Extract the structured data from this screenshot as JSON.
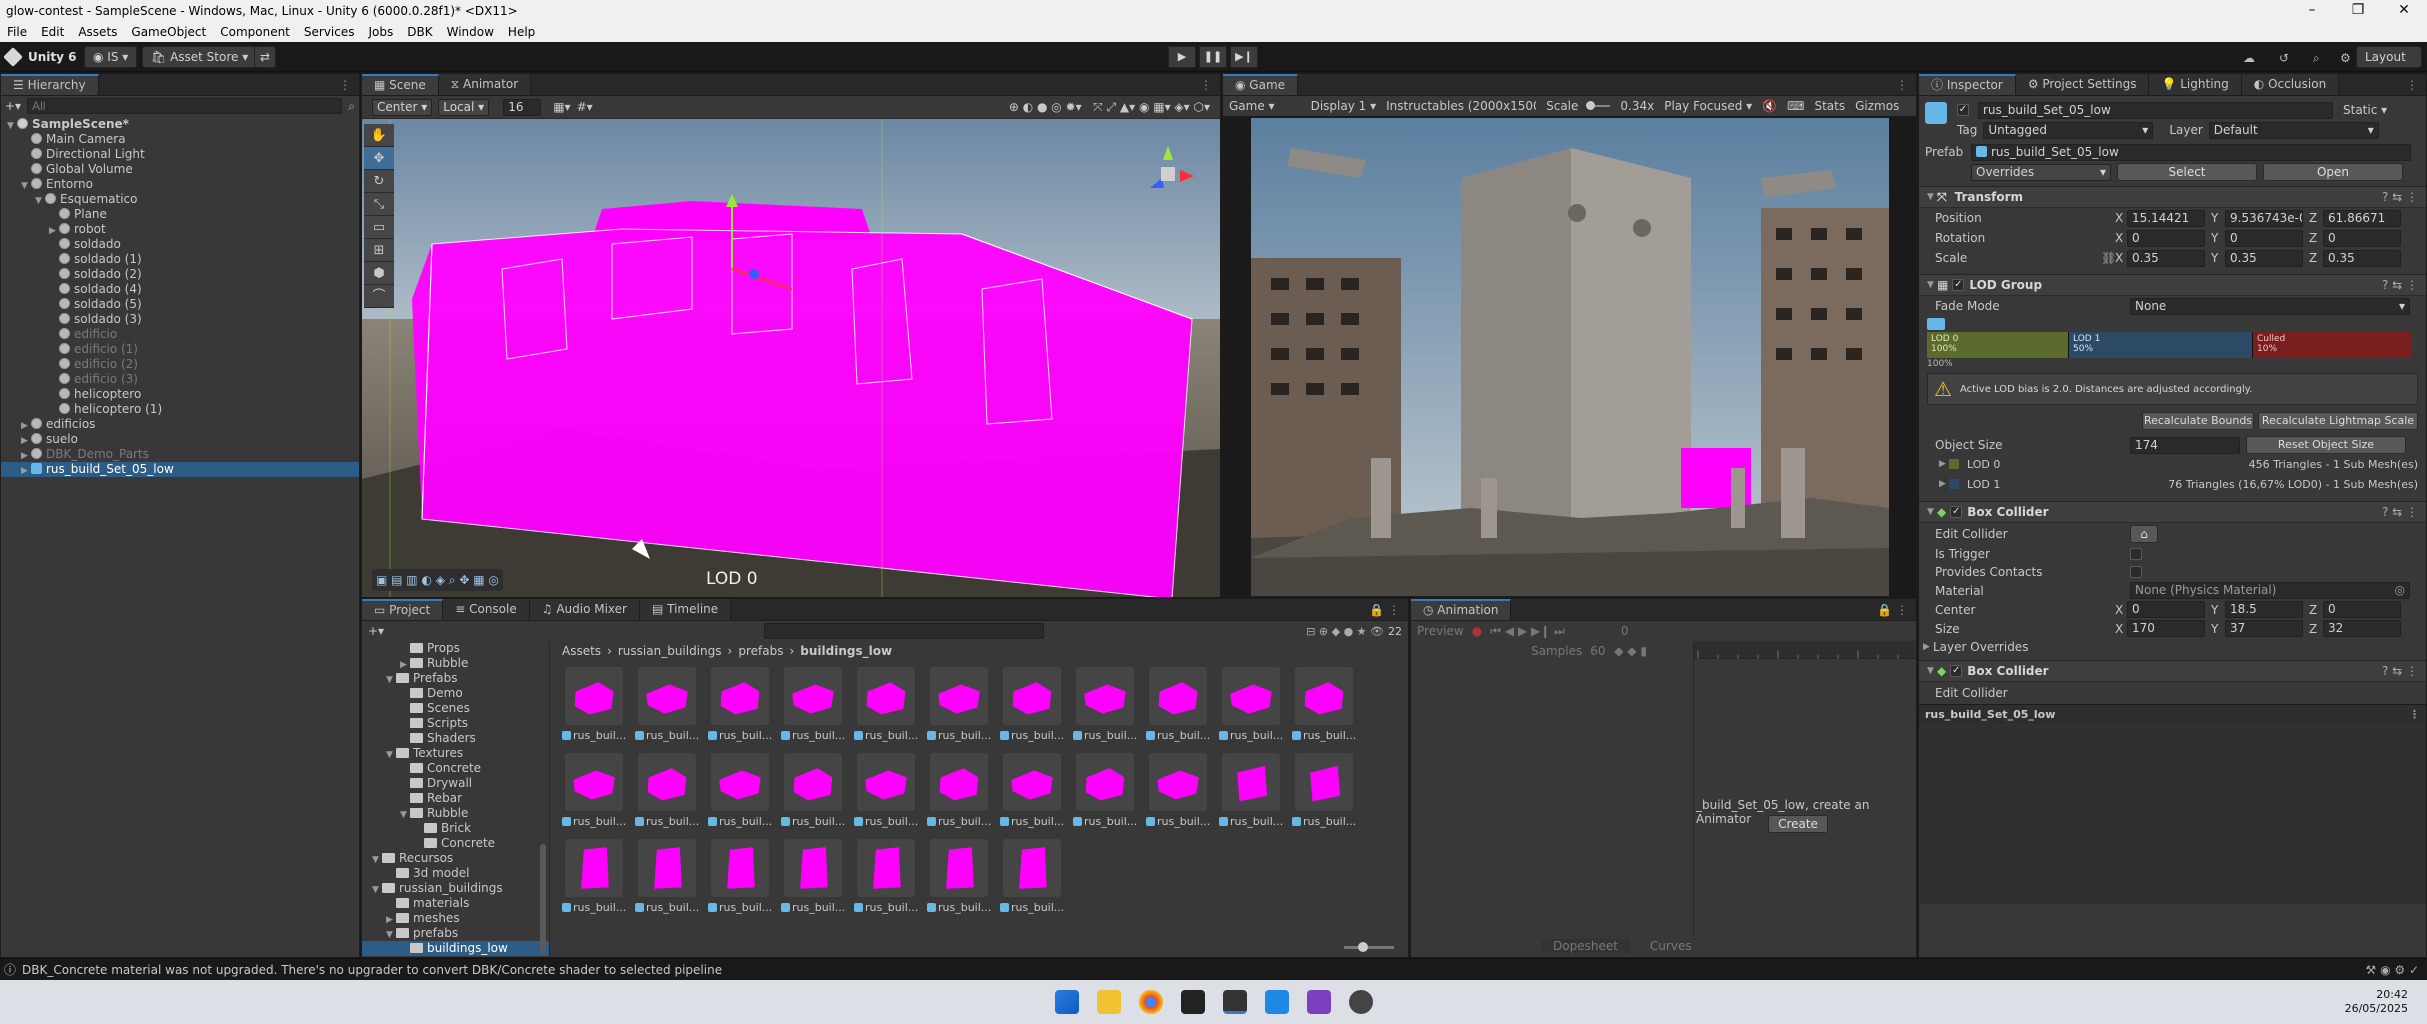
{
  "window": {
    "title": "glow-contest - SampleScene - Windows, Mac, Linux - Unity 6 (6000.0.28f1)* <DX11>",
    "minimize": "–",
    "maximize": "❐",
    "close": "✕"
  },
  "menu": [
    "File",
    "Edit",
    "Assets",
    "GameObject",
    "Component",
    "Services",
    "Jobs",
    "DBK",
    "Window",
    "Help"
  ],
  "toolbar": {
    "unity_label": "Unity 6",
    "account": "IS",
    "asset_store": "Asset Store",
    "layout": "Layout"
  },
  "hierarchy": {
    "tab": "Hierarchy",
    "search_placeholder": "All",
    "items": [
      {
        "label": "SampleScene*",
        "indent": 0,
        "type": "scene",
        "arrow": "▼",
        "state": ""
      },
      {
        "label": "Main Camera",
        "indent": 1,
        "type": "go",
        "arrow": "",
        "state": ""
      },
      {
        "label": "Directional Light",
        "indent": 1,
        "type": "go",
        "arrow": "",
        "state": ""
      },
      {
        "label": "Global Volume",
        "indent": 1,
        "type": "go",
        "arrow": "",
        "state": ""
      },
      {
        "label": "Entorno",
        "indent": 1,
        "type": "go",
        "arrow": "▼",
        "state": ""
      },
      {
        "label": "Esquematico",
        "indent": 2,
        "type": "go",
        "arrow": "▼",
        "state": ""
      },
      {
        "label": "Plane",
        "indent": 3,
        "type": "go",
        "arrow": "",
        "state": ""
      },
      {
        "label": "robot",
        "indent": 3,
        "type": "go",
        "arrow": "▶",
        "state": ""
      },
      {
        "label": "soldado",
        "indent": 3,
        "type": "go",
        "arrow": "",
        "state": ""
      },
      {
        "label": "soldado (1)",
        "indent": 3,
        "type": "go",
        "arrow": "",
        "state": ""
      },
      {
        "label": "soldado (2)",
        "indent": 3,
        "type": "go",
        "arrow": "",
        "state": ""
      },
      {
        "label": "soldado (4)",
        "indent": 3,
        "type": "go",
        "arrow": "",
        "state": ""
      },
      {
        "label": "soldado (5)",
        "indent": 3,
        "type": "go",
        "arrow": "",
        "state": ""
      },
      {
        "label": "soldado (3)",
        "indent": 3,
        "type": "go",
        "arrow": "",
        "state": ""
      },
      {
        "label": "edificio",
        "indent": 3,
        "type": "go",
        "arrow": "",
        "state": "dim"
      },
      {
        "label": "edificio (1)",
        "indent": 3,
        "type": "go",
        "arrow": "",
        "state": "dim"
      },
      {
        "label": "edificio (2)",
        "indent": 3,
        "type": "go",
        "arrow": "",
        "state": "dim"
      },
      {
        "label": "edificio (3)",
        "indent": 3,
        "type": "go",
        "arrow": "",
        "state": "dim"
      },
      {
        "label": "helicoptero",
        "indent": 3,
        "type": "go",
        "arrow": "",
        "state": ""
      },
      {
        "label": "helicoptero (1)",
        "indent": 3,
        "type": "go",
        "arrow": "",
        "state": ""
      },
      {
        "label": "edificios",
        "indent": 1,
        "type": "go",
        "arrow": "▶",
        "state": ""
      },
      {
        "label": "suelo",
        "indent": 1,
        "type": "go",
        "arrow": "▶",
        "state": ""
      },
      {
        "label": "DBK_Demo_Parts",
        "indent": 1,
        "type": "go",
        "arrow": "▶",
        "state": "dim"
      },
      {
        "label": "rus_build_Set_05_low",
        "indent": 1,
        "type": "pf",
        "arrow": "▶",
        "state": "sel"
      }
    ]
  },
  "scene": {
    "tabs": [
      "Scene",
      "Animator"
    ],
    "pivot": "Center",
    "space": "Local",
    "grid_size": "16",
    "lod_label": "LOD 0"
  },
  "game": {
    "tab": "Game",
    "mode": "Game",
    "display": "Display 1",
    "resolution": "Instructables (2000x1500)",
    "scale_label": "Scale",
    "scale_value": "0.34x",
    "play_focused": "Play Focused",
    "stats": "Stats",
    "gizmos": "Gizmos"
  },
  "inspector": {
    "tabs": [
      "Inspector",
      "Project Settings",
      "Lighting",
      "Occlusion"
    ],
    "object_name": "rus_build_Set_05_low",
    "static_label": "Static",
    "tag_label": "Tag",
    "tag_value": "Untagged",
    "layer_label": "Layer",
    "layer_value": "Default",
    "prefab_label": "Prefab",
    "prefab_value": "rus_build_Set_05_low",
    "overrides": "Overrides",
    "select_btn": "Select",
    "open_btn": "Open",
    "transform": {
      "title": "Transform",
      "position_label": "Position",
      "rotation_label": "Rotation",
      "scale_label": "Scale",
      "position": {
        "x": "15.14421",
        "y": "9.536743e-0",
        "z": "61.86671"
      },
      "rotation": {
        "x": "0",
        "y": "0",
        "z": "0"
      },
      "scale": {
        "x": "0.35",
        "y": "0.35",
        "z": "0.35"
      }
    },
    "lod_group": {
      "title": "LOD Group",
      "fade_mode_label": "Fade Mode",
      "fade_mode_value": "None",
      "lod0": "LOD 0",
      "lod0_pct": "100%",
      "lod1": "LOD 1",
      "lod1_pct": "50%",
      "culled": "Culled",
      "culled_pct": "10%",
      "top_pct": "100%",
      "warning": "Active LOD bias is 2.0. Distances are adjusted accordingly.",
      "recalc_bounds": "Recalculate Bounds",
      "recalc_lightmap": "Recalculate Lightmap Scale",
      "object_size_label": "Object Size",
      "object_size_value": "174",
      "reset_size": "Reset Object Size",
      "lod0_row": "LOD 0",
      "lod0_info": "456 Triangles - 1 Sub Mesh(es)",
      "lod1_row": "LOD 1",
      "lod1_info": "76 Triangles (16,67% LOD0) - 1 Sub Mesh(es)"
    },
    "box_collider": {
      "title": "Box Collider",
      "edit_collider": "Edit Collider",
      "is_trigger": "Is Trigger",
      "provides_contacts": "Provides Contacts",
      "material_label": "Material",
      "material_value": "None (Physics Material)",
      "center_label": "Center",
      "center": {
        "x": "0",
        "y": "18.5",
        "z": "0"
      },
      "size_label": "Size",
      "size": {
        "x": "170",
        "y": "37",
        "z": "32"
      },
      "layer_overrides": "Layer Overrides"
    },
    "box_collider2": {
      "title": "Box Collider",
      "edit_collider": "Edit Collider"
    },
    "footer_name": "rus_build_Set_05_low"
  },
  "project": {
    "tabs": [
      "Project",
      "Console",
      "Audio Mixer",
      "Timeline"
    ],
    "breadcrumb": [
      "Assets",
      "russian_buildings",
      "prefabs",
      "buildings_low"
    ],
    "count": "22",
    "tree": [
      {
        "label": "Props",
        "indent": 2,
        "arrow": ""
      },
      {
        "label": "Rubble",
        "indent": 2,
        "arrow": "▶"
      },
      {
        "label": "Prefabs",
        "indent": 1,
        "arrow": "▼"
      },
      {
        "label": "Demo",
        "indent": 2,
        "arrow": ""
      },
      {
        "label": "Scenes",
        "indent": 2,
        "arrow": ""
      },
      {
        "label": "Scripts",
        "indent": 2,
        "arrow": ""
      },
      {
        "label": "Shaders",
        "indent": 2,
        "arrow": ""
      },
      {
        "label": "Textures",
        "indent": 1,
        "arrow": "▼"
      },
      {
        "label": "Concrete",
        "indent": 2,
        "arrow": ""
      },
      {
        "label": "Drywall",
        "indent": 2,
        "arrow": ""
      },
      {
        "label": "Rebar",
        "indent": 2,
        "arrow": ""
      },
      {
        "label": "Rubble",
        "indent": 2,
        "arrow": "▼"
      },
      {
        "label": "Brick",
        "indent": 3,
        "arrow": ""
      },
      {
        "label": "Concrete",
        "indent": 3,
        "arrow": ""
      },
      {
        "label": "Recursos",
        "indent": 0,
        "arrow": "▼"
      },
      {
        "label": "3d model",
        "indent": 1,
        "arrow": ""
      },
      {
        "label": "russian_buildings",
        "indent": 0,
        "arrow": "▼"
      },
      {
        "label": "materials",
        "indent": 1,
        "arrow": ""
      },
      {
        "label": "meshes",
        "indent": 1,
        "arrow": "▶"
      },
      {
        "label": "prefabs",
        "indent": 1,
        "arrow": "▼"
      },
      {
        "label": "buildings_low",
        "indent": 2,
        "arrow": ""
      }
    ],
    "item_label": "rus_buil...",
    "item_count": 29
  },
  "animation": {
    "tab": "Animation",
    "preview": "Preview",
    "samples_label": "Samples",
    "samples_value": "60",
    "frame": "0",
    "message": "_build_Set_05_low, create an Animator",
    "create_btn": "Create",
    "dopesheet": "Dopesheet",
    "curves": "Curves"
  },
  "status": {
    "message": "DBK_Concrete material was not upgraded. There's no upgrader to convert DBK/Concrete shader to selected pipeline"
  },
  "taskbar": {
    "time": "20:42",
    "date": "26/05/2025"
  },
  "colors": {
    "accent": "#3a79bb",
    "selection": "#2c5d87",
    "magenta": "#ff00ff",
    "lod0": "#5a6b2d",
    "lod1": "#2c4a66",
    "culled": "#7a1f1f"
  }
}
